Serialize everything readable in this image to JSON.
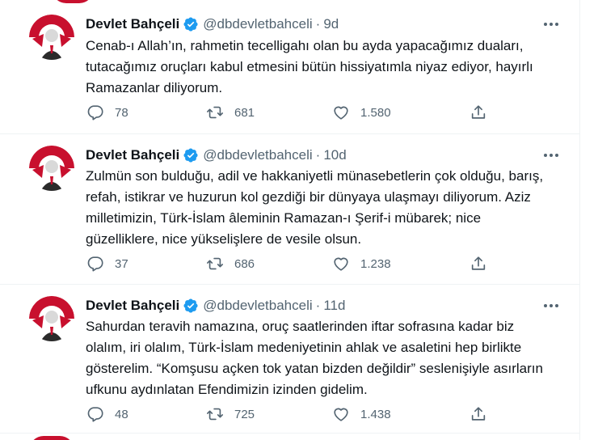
{
  "accent_color": "#1d9bf0",
  "brand_red": "#c8102e",
  "icons": {
    "verified": "verified-badge-icon",
    "more": "more-horizontal-icon",
    "reply": "reply-bubble-icon",
    "retweet": "retweet-arrows-icon",
    "like": "heart-outline-icon",
    "share": "share-upload-icon"
  },
  "tweets": [
    {
      "author_name": "Devlet Bahçeli",
      "handle": "@dbdevletbahceli",
      "separator": "·",
      "time": "9d",
      "text": "Cenab-ı Allah’ın, rahmetin tecelligahı olan bu ayda yapacağımız duaları,\ntutacağımız oruçları kabul etmesini bütün hissiyatımla niyaz ediyor, hayırlı\nRamazanlar diliyorum.",
      "replies": "78",
      "retweets": "681",
      "likes": "1.580"
    },
    {
      "author_name": "Devlet Bahçeli",
      "handle": "@dbdevletbahceli",
      "separator": "·",
      "time": "10d",
      "text": "Zulmün son bulduğu, adil ve hakkaniyetli münasebetlerin çok olduğu, barış,\nrefah, istikrar ve huzurun kol gezdiği bir dünyaya ulaşmayı diliyorum. Aziz\nmilletimizin, Türk-İslam âleminin Ramazan-ı Şerif-i mübarek; nice\ngüzelliklere, nice yükselişlere de vesile olsun.",
      "replies": "37",
      "retweets": "686",
      "likes": "1.238"
    },
    {
      "author_name": "Devlet Bahçeli",
      "handle": "@dbdevletbahceli",
      "separator": "·",
      "time": "11d",
      "text": "Sahurdan teravih namazına, oruç saatlerinden iftar sofrasına kadar biz\nolalım, iri olalım, Türk-İslam medeniyetinin ahlak ve asaletini hep birlikte\ngösterelim. “Komşusu açken tok yatan bizden değildir” seslenişiyle asırların\nufkunu aydınlatan Efendimizin izinden gidelim.",
      "replies": "48",
      "retweets": "725",
      "likes": "1.438"
    }
  ]
}
